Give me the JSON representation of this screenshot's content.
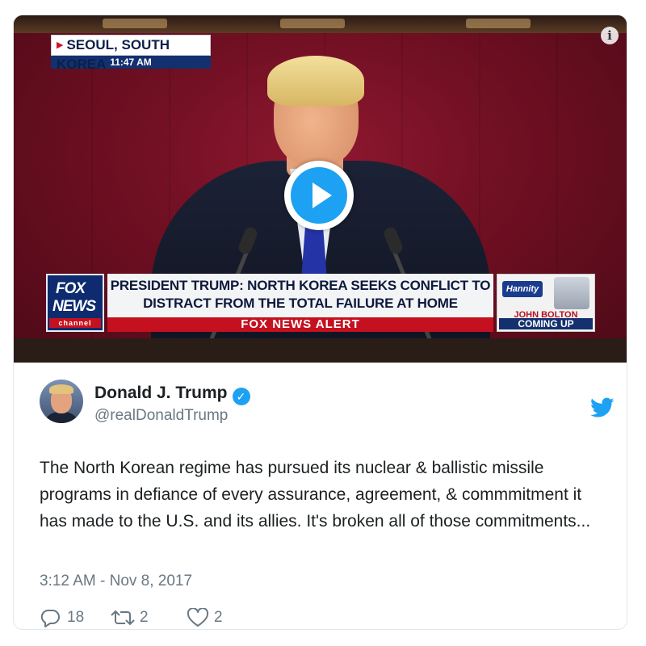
{
  "video": {
    "location": "SEOUL, SOUTH KOREA",
    "time": "11:47 AM",
    "channel_logo_line1": "FOX",
    "channel_logo_line2": "NEWS",
    "channel_logo_line3": "channel",
    "headline_line1": "PRESIDENT TRUMP: NORTH KOREA SEEKS CONFLICT TO",
    "headline_line2": "DISTRACT FROM THE TOTAL FAILURE AT HOME",
    "alert": "FOX NEWS ALERT",
    "promo_show": "Hannity",
    "promo_guest": "JOHN BOLTON",
    "promo_next": "COMING UP",
    "icons": {
      "info": "info-icon",
      "play": "play-icon"
    }
  },
  "tweet": {
    "author_name": "Donald J. Trump",
    "author_handle": "@realDonaldTrump",
    "text": "The North Korean regime has pursued its nuclear & ballistic missile programs in defiance of every assurance, agreement, & commmitment it has made to the U.S. and its allies. It's broken all of those commitments...",
    "timestamp": "3:12 AM - Nov 8, 2017",
    "replies": "18",
    "retweets": "2",
    "likes": "2",
    "icons": {
      "verified": "verified-badge-icon",
      "brand": "twitter-bird-icon",
      "reply": "reply-icon",
      "retweet": "retweet-icon",
      "like": "heart-icon"
    },
    "colors": {
      "accent": "#1da1f2",
      "muted": "#697882",
      "text": "#1c2022"
    }
  }
}
